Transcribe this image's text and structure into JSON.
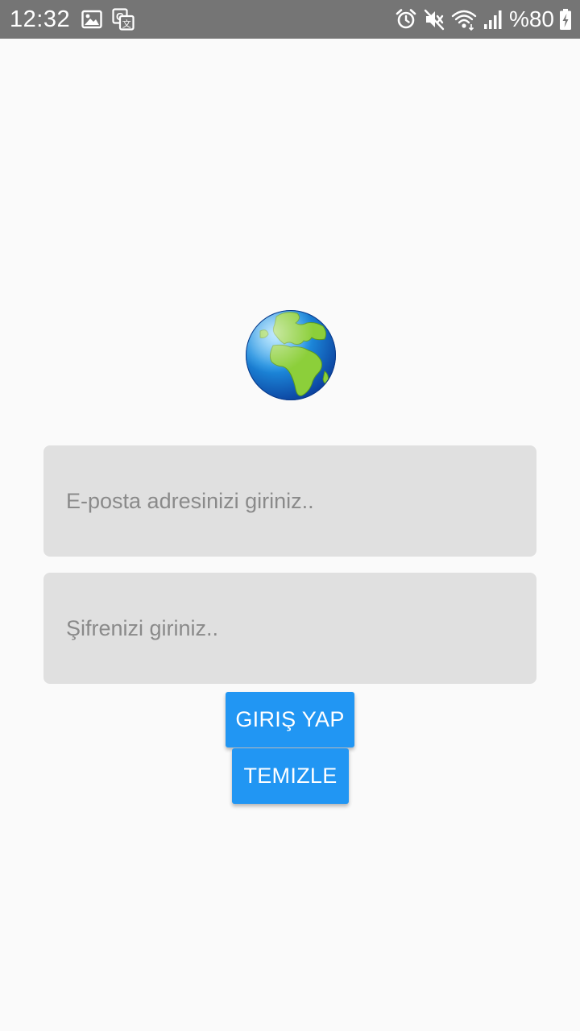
{
  "status_bar": {
    "time": "12:32",
    "battery": "%80",
    "left_icons": [
      "image-icon",
      "translate-icon"
    ],
    "right_icons": [
      "alarm-icon",
      "mute-icon",
      "wifi-icon",
      "signal-icon",
      "battery-charging-icon"
    ],
    "background": "#757575"
  },
  "logo": {
    "icon": "globe-europe-africa-icon"
  },
  "form": {
    "email_placeholder": "E-posta adresinizi giriniz..",
    "password_placeholder": "Şifrenizi giriniz..",
    "email_value": "",
    "password_value": ""
  },
  "buttons": {
    "login_label": "GIRIŞ YAP",
    "clear_label": "TEMIZLE",
    "color": "#2196f3"
  },
  "colors": {
    "background": "#fafafa",
    "field_background": "#e0e0e0",
    "placeholder": "#8a8a8a"
  }
}
